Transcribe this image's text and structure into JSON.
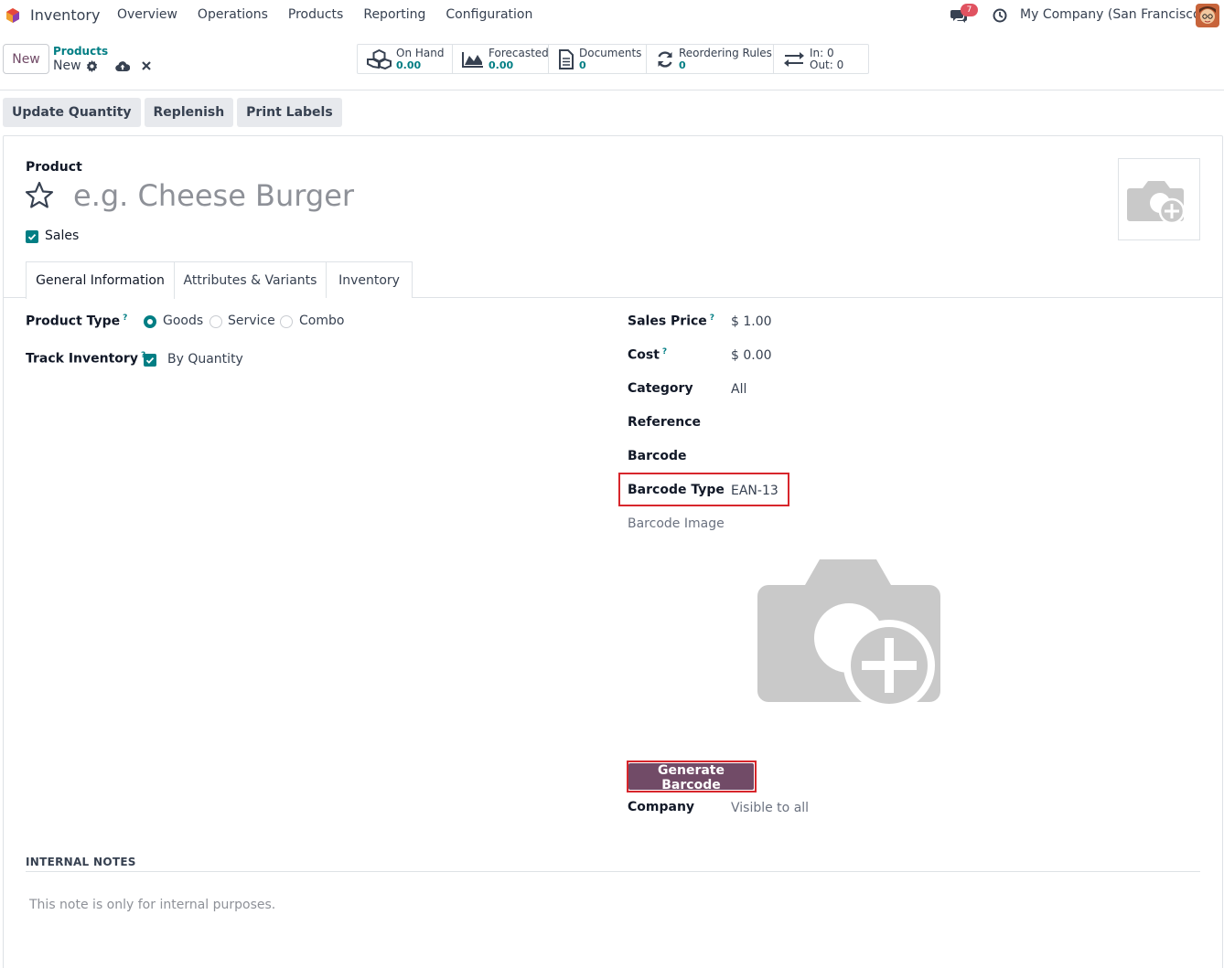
{
  "navbar": {
    "app_name": "Inventory",
    "menu": [
      "Overview",
      "Operations",
      "Products",
      "Reporting",
      "Configuration"
    ],
    "chat_badge": "7",
    "company": "My Company (San Francisco)"
  },
  "control": {
    "new_label": "New",
    "breadcrumb_parent": "Products",
    "breadcrumb_current": "New",
    "smart_buttons": [
      {
        "label": "On Hand",
        "value": "0.00"
      },
      {
        "label": "Forecasted",
        "value": "0.00"
      },
      {
        "label": "Documents",
        "value": "0"
      },
      {
        "label": "Reordering Rules",
        "value": "0"
      },
      {
        "label": "In: 0",
        "value": "Out: 0"
      }
    ]
  },
  "actions": [
    "Update Quantity",
    "Replenish",
    "Print Labels"
  ],
  "form": {
    "product_label": "Product",
    "name_placeholder": "e.g. Cheese Burger",
    "sales_label": "Sales",
    "tabs": [
      "General Information",
      "Attributes & Variants",
      "Inventory"
    ],
    "product_type_label": "Product Type",
    "help": "?",
    "product_type_options": [
      "Goods",
      "Service",
      "Combo"
    ],
    "product_type_selected": "Goods",
    "track_inventory_label": "Track Inventory",
    "track_inventory_value": "By Quantity",
    "sales_price_label": "Sales Price",
    "sales_price": "$ 1.00",
    "cost_label": "Cost",
    "cost": "$ 0.00",
    "category_label": "Category",
    "category": "All",
    "reference_label": "Reference",
    "barcode_label": "Barcode",
    "barcode_type_label": "Barcode Type",
    "barcode_type": "EAN-13",
    "barcode_image_label": "Barcode Image",
    "generate_barcode": "Generate Barcode",
    "company_label": "Company",
    "company_placeholder": "Visible to all",
    "notes_title": "INTERNAL NOTES",
    "notes_placeholder": "This note is only for internal purposes."
  },
  "colors": {
    "brand": "#714B67",
    "accent": "#017e84",
    "highlight": "#d7262c"
  }
}
